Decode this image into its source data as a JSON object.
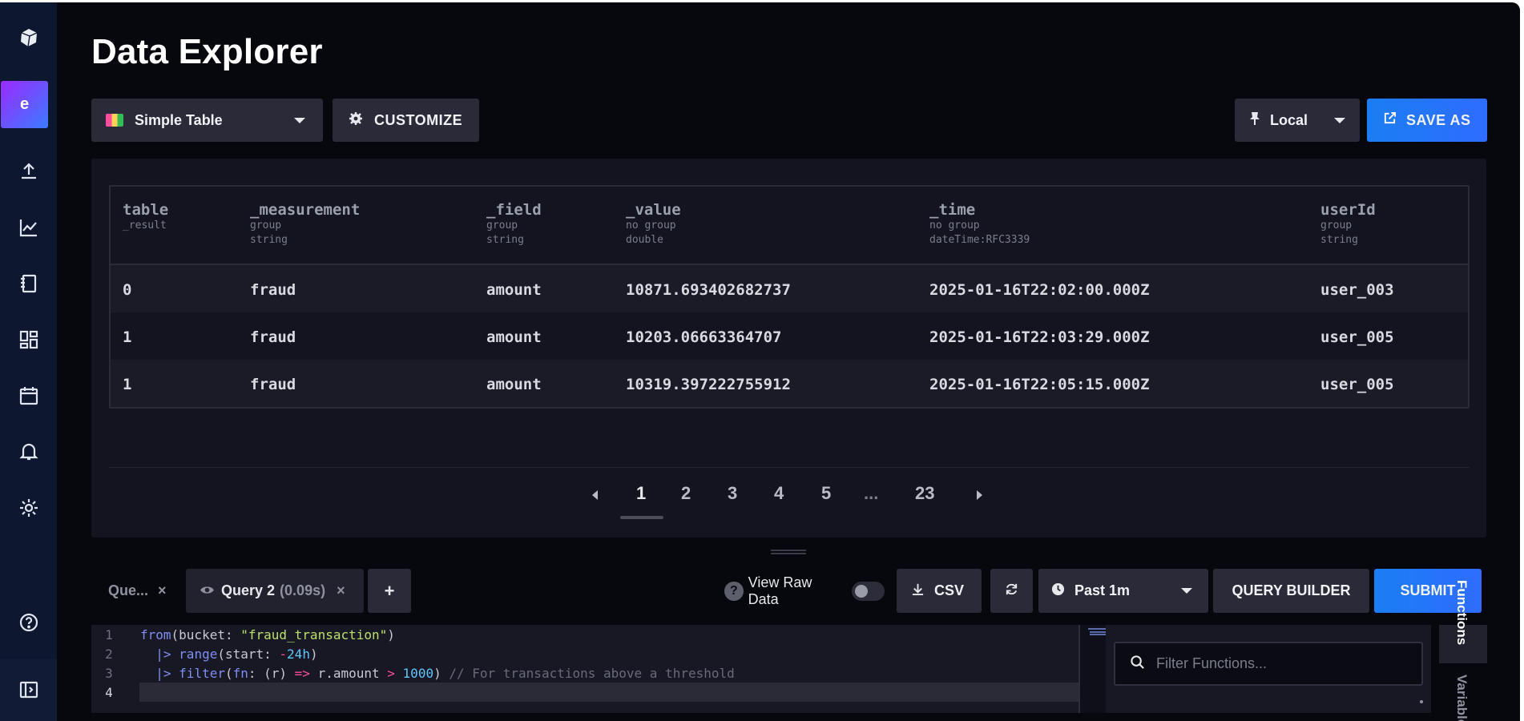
{
  "page": {
    "title": "Data Explorer"
  },
  "sidebar": {
    "org_initial": "e",
    "icons": [
      "logo-icon",
      "upload-icon",
      "graph-icon",
      "notebook-icon",
      "dashboard-icon",
      "calendar-icon",
      "bell-icon",
      "gear-icon",
      "help-icon",
      "collapse-icon"
    ]
  },
  "toolbar": {
    "viz_type": "Simple Table",
    "customize_label": "CUSTOMIZE",
    "timezone": "Local",
    "save_as_label": "SAVE AS"
  },
  "table": {
    "columns": [
      {
        "name": "table",
        "sub": [
          "_result"
        ]
      },
      {
        "name": "_measurement",
        "sub": [
          "group",
          "string"
        ]
      },
      {
        "name": "_field",
        "sub": [
          "group",
          "string"
        ]
      },
      {
        "name": "_value",
        "sub": [
          "no group",
          "double"
        ]
      },
      {
        "name": "_time",
        "sub": [
          "no group",
          "dateTime:RFC3339"
        ]
      },
      {
        "name": "userId",
        "sub": [
          "group",
          "string"
        ]
      }
    ],
    "rows": [
      [
        "0",
        "fraud",
        "amount",
        "10871.693402682737",
        "2025-01-16T22:02:00.000Z",
        "user_003"
      ],
      [
        "1",
        "fraud",
        "amount",
        "10203.06663364707",
        "2025-01-16T22:03:29.000Z",
        "user_005"
      ],
      [
        "1",
        "fraud",
        "amount",
        "10319.397222755912",
        "2025-01-16T22:05:15.000Z",
        "user_005"
      ]
    ]
  },
  "pagination": {
    "pages": [
      "1",
      "2",
      "3",
      "4",
      "5",
      "...",
      "23"
    ],
    "current": "1"
  },
  "query_bar": {
    "tab1_label": "Que...",
    "tab2_label": "Query 2",
    "tab2_time": "(0.09s)",
    "add_label": "+",
    "view_raw_label": "View Raw Data",
    "csv_label": "CSV",
    "time_range": "Past 1m",
    "query_builder_label": "QUERY BUILDER",
    "submit_label": "SUBMIT"
  },
  "editor": {
    "line_numbers": [
      "1",
      "2",
      "3",
      "4"
    ]
  },
  "functions_panel": {
    "search_placeholder": "Filter Functions...",
    "tab_functions": "Functions",
    "tab_variables": "Variables"
  },
  "colors": {
    "accent_blue": "#1b7ef2",
    "org_gradient_start": "#9b2aff",
    "org_gradient_end": "#3b7bff",
    "sidebar_bg": "#0e1730"
  }
}
